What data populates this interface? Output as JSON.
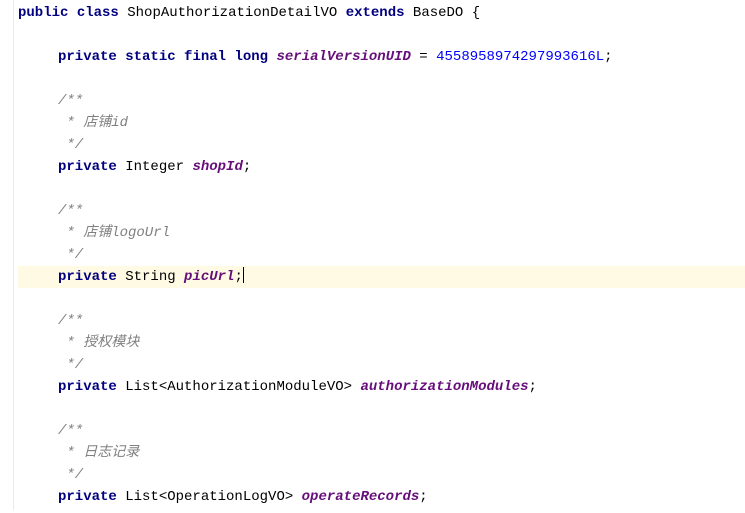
{
  "code": {
    "class_decl": {
      "kw_public": "public",
      "kw_class": "class",
      "class_name": "ShopAuthorizationDetailVO",
      "kw_extends": "extends",
      "base_name": "BaseDO",
      "open_brace": " {"
    },
    "serial": {
      "kw_private": "private",
      "kw_static": "static",
      "kw_final": "final",
      "kw_long": "long",
      "field": "serialVersionUID",
      "eq": " = ",
      "value": "4558958974297993616L",
      "semi": ";"
    },
    "blocks": [
      {
        "c_open": "/**",
        "c_body": " * 店铺id",
        "c_close": " */",
        "kw_private": "private",
        "type": "Integer",
        "field": "shopId",
        "semi": ";"
      },
      {
        "c_open": "/**",
        "c_body": " * 店铺logoUrl",
        "c_close": " */",
        "kw_private": "private",
        "type": "String",
        "field": "picUrl",
        "semi": ";"
      },
      {
        "c_open": "/**",
        "c_body": " * 授权模块",
        "c_close": " */",
        "kw_private": "private",
        "type": "List<AuthorizationModuleVO>",
        "field": "authorizationModules",
        "semi": ";"
      },
      {
        "c_open": "/**",
        "c_body": " * 日志记录",
        "c_close": " */",
        "kw_private": "private",
        "type": "List<OperationLogVO>",
        "field": "operateRecords",
        "semi": ";"
      }
    ]
  }
}
